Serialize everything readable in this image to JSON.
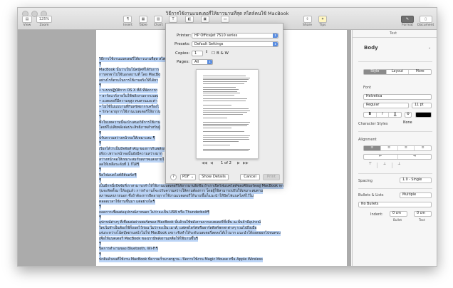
{
  "window": {
    "title": "วิธีการใช้งานแบตเตอรี่ให้ยาวนานที่สุด สไตล์คนใช้ MacBook"
  },
  "toolbar": {
    "view": "View",
    "zoom": "Zoom",
    "zoom_value": "125%",
    "insert": "Insert",
    "table": "Table",
    "chart": "Chart",
    "text": "Text",
    "shape": "Shape",
    "media": "Media",
    "comment": "Comment",
    "share": "Share",
    "tips": "Tips",
    "format": "Format",
    "document": "Document"
  },
  "document": {
    "lines": [
      {
        "text": "วิธีการใช้งานแบตเตอรี่ให้ยาวนานที่สุด สไต",
        "sel": true
      },
      {
        "text": "¶",
        "sel": true
      },
      {
        "text": "MacBook นั้นว่าเป็นโน้ตบุ๊คที่ได้รับการ",
        "sel": true
      },
      {
        "text": "การพกพาไปใช้นอกสถานที่ โดย MacBo",
        "sel": true
      },
      {
        "text": "อย่างไรก็ตามในการใช้งานจริงให้ได้ยา",
        "sel": true
      },
      {
        "text": "¶",
        "sel": true
      },
      {
        "text": "• ระบบปฏิบัติการ OS X ที่ดี ที่จัดการก",
        "sel": true
      },
      {
        "text": "• ฮาร์ดแวร์ภายในใช้พลังงานจากแบตเ",
        "sel": true
      },
      {
        "text": "• แบตเตอรี่มีความจุสูง ทนทานและค่า",
        "sel": true
      },
      {
        "text": "• ไม่ใช้ไม่แบบานที่กินทรัพยากรเครื่องไ",
        "sel": true
      },
      {
        "text": "• รักษาอายุการใช้งานแบตเตอรี่ให้ยาวน",
        "sel": true
      },
      {
        "text": "¶",
        "sel": true
      },
      {
        "text": "ซึ่งในบทความนี้จะนำเสนอวิธีการใช้งาน",
        "sel": true
      },
      {
        "text": "โดยที่ไม่เสียพลังต่อประสิทธิภาพสำหรับผู้",
        "sel": true
      },
      {
        "text": "¶",
        "sel": true
      },
      {
        "text": "ปรับความสว่างหน้าจอให้เหมาะสม ¶",
        "sel": true
      },
      {
        "text": "¶",
        "sel": true
      },
      {
        "text": "เรียกได้ว่าเป็นปัจจัยสำคัญ ของการกินพลังง",
        "sel": true
      },
      {
        "text": "เดียว เพราะหน้าจอนั้นยังมีความสว่างมาก",
        "sel": true
      },
      {
        "text": "สว่างหน้าจอให้เหมาะสมกับสภาพแสงภายใ",
        "sel": true
      },
      {
        "text": "ลดให้เหลือระดับที่ 1 ก็ได้¶",
        "sel": true
      },
      {
        "text": "¶",
        "sel": true
      },
      {
        "text": "ปิดไฟแบคไลท์คีย์บอร์ด¶",
        "sel": true
      },
      {
        "text": "¶",
        "sel": true
      },
      {
        "text": "เป็นอีกหนึ่งปัจจัยที่เราสามารถทำให้ใช้งานแบตเตอรี่ได้ยาวนานยิ่งขึ้น ถ้าเราเปิดไฟแบคไลท์ของคีย์บอร์ดอยู่ MacBook ทุก",
        "sel": true
      },
      {
        "text": "รุ่นจะติดตั้งมาให้อยู่แล้ว การทำงานก็จะปรับความสว่างให้ตามต้องการ โดยผู้ใช้สามารถปรับให้เหมาะสมตาม",
        "sel": true
      },
      {
        "text": "สภาพแสงภายนอก ซึ่งถ้าต้องการยืดอายุการใช้งานแบตเตอรี่ให้นานขึ้นก็แนะนำให้ปิดไฟแบคไลท์ไว้ไม่",
        "sel": true
      },
      {
        "text": "ตลอดเวลาใช้งานขึ้นมา แต่อย่างใด¶",
        "sel": true
      },
      {
        "text": "¶",
        "sel": true
      },
      {
        "text": "ถอดการเชื่อมต่ออุปกรณ์ภายนอก ไม่ว่าจะเป็น USB หรือ Thunderbolt¶",
        "sel": true
      },
      {
        "text": "¶",
        "sel": true
      },
      {
        "text": "อุปกรณ์ต่างๆ ที่เชื่อมต่อผ่านพอร์ตของ MacBook นั้นล้วนใช้พลังงานจากแบตเตอรี่ทั้งสิ้น ฉะนั้นถ้ามีอุปกรณ์",
        "sel": true
      },
      {
        "text": "ใดบไม่จำเป็นต้องใช้ก็ถอดไว้ก่อน ไม่ว่าจะเป็น เมาส์, แฟลชไดร์ฟหรือฮาร์ดดิสก์พกพาต่างๆ รวมไปถึงเมื่อ",
        "sel": true
      },
      {
        "text": "เล่นระหว่างโน้ตบุ๊คผ่านหน้าไม่ใช่ MacBook เพราะชิงทำให้ระดับเบตเตอรี่ลดลงได้เร็วมาก แนะนำให้ถอดออกไปจนครบ",
        "sel": true
      },
      {
        "text": "เพื่อให้แบตเตอรี่ MacBook ของเรามีพลังงานเหลือให้ใช้นานขึ้น¶",
        "sel": true
      },
      {
        "text": "¶",
        "sel": true
      },
      {
        "text": "ปิดการทำงานของ Bluetooth, Wi-Fi¶",
        "sel": true
      },
      {
        "text": "¶",
        "sel": true
      },
      {
        "text": "ปกติแล้วคนที่ใช้งาน MacBook ที่ความเร็วมาตรฐาน...ปิดการใช้งาน Magic Mouse หรือ Apple Wireless",
        "sel": true
      }
    ]
  },
  "inspector": {
    "tab": "Text",
    "para_style": "Body",
    "style_tabs": [
      "Style",
      "Layout",
      "More"
    ],
    "font_header": "Font",
    "font_name": "Helvetica",
    "font_weight": "Regular",
    "font_size": "11 pt",
    "bius": [
      "B",
      "I",
      "U"
    ],
    "gear": "⚙",
    "char_styles_label": "Character Styles",
    "char_styles_value": "None",
    "alignment_header": "Alignment",
    "indent_dec": "⇤",
    "indent_inc": "⇥",
    "spacing_label": "Spacing",
    "spacing_value": "1.0 - Single",
    "bullets_label": "Bullets & Lists",
    "bullets_value": "Multiple",
    "no_bullets": "No Bullets",
    "indent_label": "Indent:",
    "bullet_indent": "0 cm",
    "text_indent": "0 cm",
    "bullet_caption": "Bullet",
    "text_caption": "Text"
  },
  "print": {
    "printer_label": "Printer:",
    "printer_value": "HP OfficeJet 7510 series",
    "presets_label": "Presets:",
    "presets_value": "Default Settings",
    "copies_label": "Copies:",
    "copies_value": "1",
    "bw_label": "B & W",
    "pages_label": "Pages:",
    "pages_value": "All",
    "page_counter": "1 of 2",
    "help": "?",
    "pdf": "PDF",
    "show_details": "Show Details",
    "cancel": "Cancel",
    "print": "Print"
  }
}
